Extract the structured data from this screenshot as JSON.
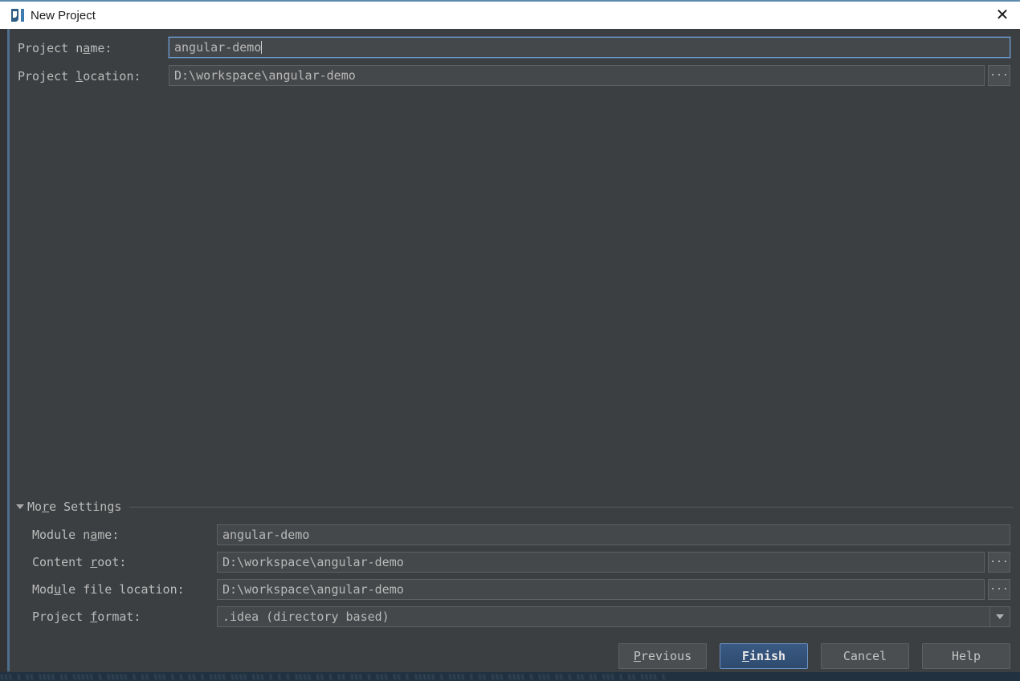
{
  "window": {
    "title": "New Project",
    "app_icon": "intellij-idea-icon",
    "close_icon": "close-icon",
    "accent_color": "#5a8bb0",
    "background_color": "#3c3f41",
    "titlebar_color": "#ffffff"
  },
  "form": {
    "project_name": {
      "label_pre": "Project n",
      "label_mnemonic": "a",
      "label_post": "me:",
      "value": "angular-demo",
      "focused": true
    },
    "project_location": {
      "label_pre": "Project ",
      "label_mnemonic": "l",
      "label_post": "ocation:",
      "value": "D:\\workspace\\angular-demo",
      "browse_label": "...",
      "browse_icon": "ellipsis-icon"
    }
  },
  "more_settings": {
    "title_pre": "Mo",
    "title_mnemonic": "r",
    "title_post": "e Settings",
    "expanded": true,
    "toggle_icon": "triangle-down-icon",
    "rows": [
      {
        "label_pre": "Module n",
        "label_mnemonic": "a",
        "label_post": "me:",
        "value": "angular-demo",
        "has_browse": false,
        "type": "text"
      },
      {
        "label_pre": "Content ",
        "label_mnemonic": "r",
        "label_post": "oot:",
        "value": "D:\\workspace\\angular-demo",
        "has_browse": true,
        "browse_label": "...",
        "type": "text"
      },
      {
        "label_pre": "Mod",
        "label_mnemonic": "u",
        "label_post": "le file location:",
        "value": "D:\\workspace\\angular-demo",
        "has_browse": true,
        "browse_label": "...",
        "type": "text"
      },
      {
        "label_pre": "Project ",
        "label_mnemonic": "f",
        "label_post": "ormat:",
        "value": ".idea (directory based)",
        "has_browse": false,
        "type": "combo",
        "arrow_icon": "chevron-down-icon"
      }
    ]
  },
  "footer": {
    "buttons": [
      {
        "pre": "",
        "mnemonic": "P",
        "post": "revious",
        "default": false,
        "name": "previous-button"
      },
      {
        "pre": "",
        "mnemonic": "F",
        "post": "inish",
        "default": true,
        "name": "finish-button"
      },
      {
        "pre": "Cancel",
        "mnemonic": "",
        "post": "",
        "default": false,
        "name": "cancel-button"
      },
      {
        "pre": "Help",
        "mnemonic": "",
        "post": "",
        "default": false,
        "name": "help-button"
      }
    ]
  },
  "background_bleed": {
    "bottom_text": "lll l ll llll ll lllll l lllll l ll lll l l ll l llll llll lll l l l llll ll l ll lll l lll ll l lllll l llll l ll lll llll l lll ll l ll ll lll l ll llll l"
  }
}
